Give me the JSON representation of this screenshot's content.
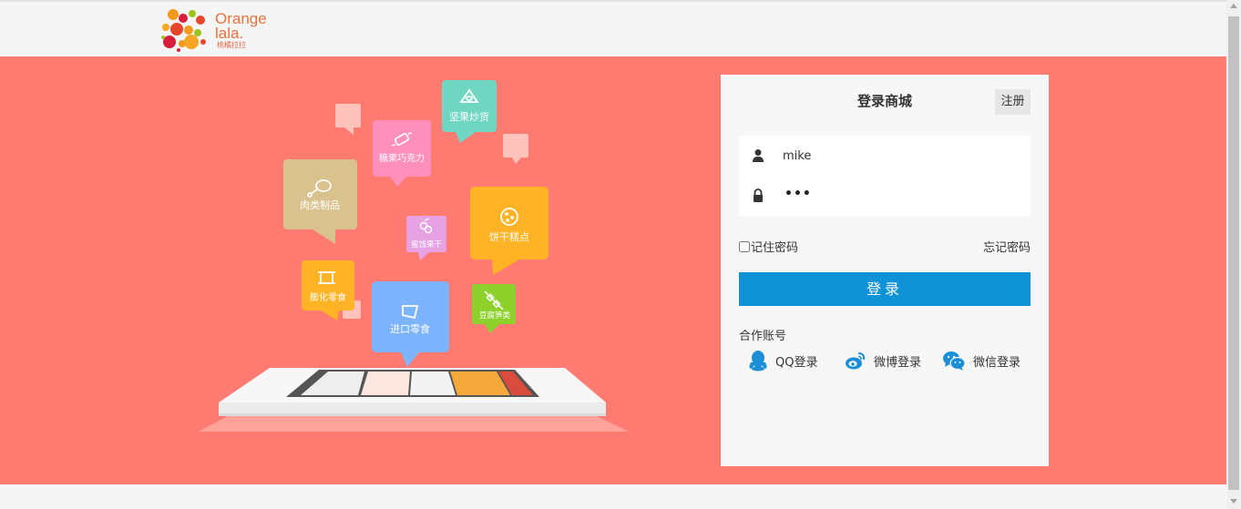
{
  "brand": {
    "logo_line1": "Orange",
    "logo_line2": "lala.",
    "logo_line3": "桃橘拉拉"
  },
  "categories": [
    {
      "label": "坚果炒货",
      "color": "#6fd6c2",
      "icon": "nut-icon"
    },
    {
      "label": "糖果巧克力",
      "color": "#ff8fbb",
      "icon": "candy-icon"
    },
    {
      "label": "肉类制品",
      "color": "#d9c28e",
      "icon": "drumstick-icon"
    },
    {
      "label": "蜜饯果干",
      "color": "#e7a2e4",
      "icon": "dried-fruit-icon"
    },
    {
      "label": "饼干糕点",
      "color": "#ffb325",
      "icon": "cookie-icon"
    },
    {
      "label": "膨化零食",
      "color": "#ffb325",
      "icon": "chips-icon"
    },
    {
      "label": "进口零食",
      "color": "#7db4ff",
      "icon": "flag-icon"
    },
    {
      "label": "豆腐笋类",
      "color": "#8fd12c",
      "icon": "skewer-icon"
    }
  ],
  "login": {
    "title": "登录商城",
    "register_label": "注册",
    "username_value": "mike",
    "password_mask": "•••",
    "remember_label": "记住密码",
    "forgot_label": "忘记密码",
    "submit_label": "登录",
    "partner_label": "合作账号",
    "social": {
      "qq_label": "QQ登录",
      "weibo_label": "微博登录",
      "wechat_label": "微信登录"
    }
  },
  "colors": {
    "banner_bg": "#ff7a70",
    "primary_button": "#0f92d6",
    "panel_bg": "#f7f7f7"
  }
}
